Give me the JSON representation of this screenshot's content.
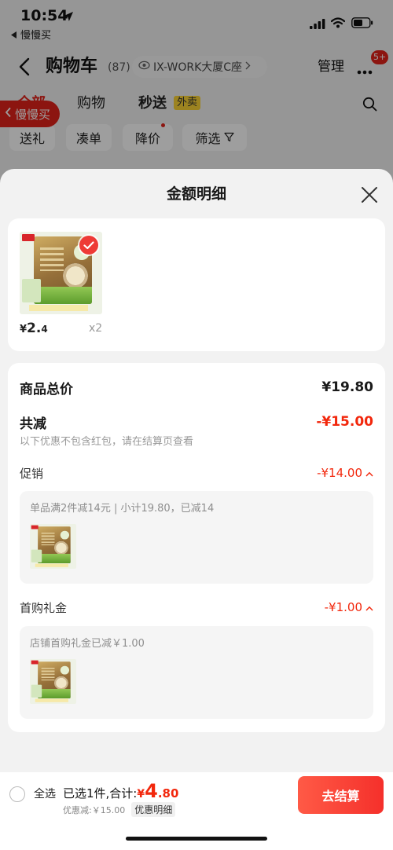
{
  "status_bar": {
    "time": "10:54",
    "back_app_label": "慢慢买"
  },
  "header": {
    "title": "购物车",
    "count": "(87)",
    "address": "IX-WORK大厦C座",
    "manage_label": "管理",
    "more_badge": "5+"
  },
  "tabs": [
    {
      "label": "全部",
      "active": true
    },
    {
      "label": "购物",
      "active": false
    },
    {
      "label": "秒送",
      "active": false,
      "tag": "外卖"
    }
  ],
  "filters": [
    {
      "label": "送礼"
    },
    {
      "label": "凑单"
    },
    {
      "label": "降价",
      "has_dot": true
    },
    {
      "label": "筛选"
    }
  ],
  "floating_back_label": "慢慢买",
  "amount_sheet": {
    "title": "金额明细",
    "product": {
      "price_symbol": "¥",
      "price_main": "2.",
      "price_minor": "4",
      "quantity": "x2",
      "selected": true
    },
    "summary": {
      "goods_total_label": "商品总价",
      "goods_total_value": "¥19.80",
      "total_discount_label": "共减",
      "total_discount_value": "-¥15.00",
      "note": "以下优惠不包含红包，请在结算页查看"
    },
    "discounts": [
      {
        "label": "促销",
        "value": "-¥14.00",
        "detail": "单品满2件减14元 | 小计19.80，已减14",
        "expanded": true
      },
      {
        "label": "首购礼金",
        "value": "-¥1.00",
        "detail": "店铺首购礼金已减￥1.00",
        "expanded": true
      }
    ]
  },
  "footer": {
    "select_all_label": "全选",
    "select_all_checked": false,
    "selected_summary": "已选1件,合计:",
    "total_symbol": "¥",
    "total_int": "4",
    "total_dec": ".80",
    "discount_text": "优惠减:￥15.00",
    "discount_detail_label": "优惠明细",
    "checkout_label": "去结算"
  },
  "colors": {
    "accent_red": "#f2270c",
    "brand_red": "#e2231a",
    "tag_yellow": "#fcd434",
    "checkout_red": "#f5302b"
  },
  "icons": [
    "location-arrow-icon",
    "back-triangle-icon",
    "signal-icon",
    "wifi-icon",
    "battery-icon",
    "back-chevron-icon",
    "location-icon",
    "chevron-right-icon",
    "more-icon",
    "search-icon",
    "filter-icon",
    "close-icon",
    "check-icon",
    "chevron-up-icon"
  ]
}
